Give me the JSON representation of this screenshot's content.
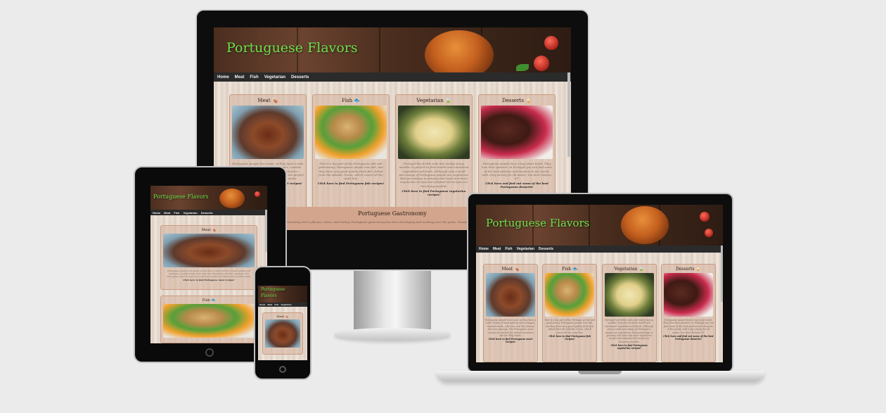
{
  "site": {
    "brand": "Portuguese Flavors",
    "brand_short_1": "Portuguese",
    "brand_short_2": "Flavors",
    "nav": [
      "Home",
      "Meat",
      "Fish",
      "Vegetarian",
      "Desserts"
    ],
    "cards": [
      {
        "title": "Meat",
        "icon": "drumstick-icon",
        "glyph": "🍗",
        "text": "Portuguese people love meat, as they have a wide variety of meat options and sausages, roasted meats, cold cuts, and the famous chourico sausage. The Portuguese meat recipes are perfect for special occasions and for daily meals.",
        "cta": "Click here to find Portuguese meat recipes!"
      },
      {
        "title": "Fish",
        "icon": "fish-icon",
        "glyph": "🐟",
        "text": "Fish is a big part of the Portuguese diet and gastronomy. Portuguese people love fish, and they have very good quality fresh fish, fished from the Atlantic Ocean, which covers all the coast line.",
        "cta": "Click here to find Portuguese fish recipes!"
      },
      {
        "title": "Vegetarian",
        "icon": "leaf-icon",
        "glyph": "🍃",
        "text": "Portugal has fertile soils and mostly sunny weather is perfect to farm health and nutritional vegetables and fruits. Although only a small percentage of Portuguese people are vegetarian, that percentage is growing and more and more vegetarian recipes and adapted old recipes are becoming popular.",
        "cta": "Click here to find Portuguese vegetarian recipes!"
      },
      {
        "title": "Desserts",
        "icon": "ice-cream-icon",
        "glyph": "🍦",
        "text": "Portuguese people have a big sweet tooth. They love their pastries. In Portugal you can find some of the best pastries and desserts in the world, with a big variety for all tastes. You don't believe it?!",
        "cta": "Click here and find out some of the best Portuguese desserts!"
      }
    ],
    "gastronomy_title": "Portuguese Gastronomy",
    "gastronomy_text": "Portugal is well known for its rich gastronomy, a gastronomy rich in flavour, colour, and history. Portuguese gastronomy has been developing and evolving over the years. Nowadays, Portugal offers a vast number of delicious gastronomic options. Including meat, fish..."
  },
  "colors": {
    "brand_green": "#6fe04a",
    "nav_bg": "#2b2b2b",
    "card_border": "#c99a80",
    "page_bg": "#ebebeb"
  }
}
